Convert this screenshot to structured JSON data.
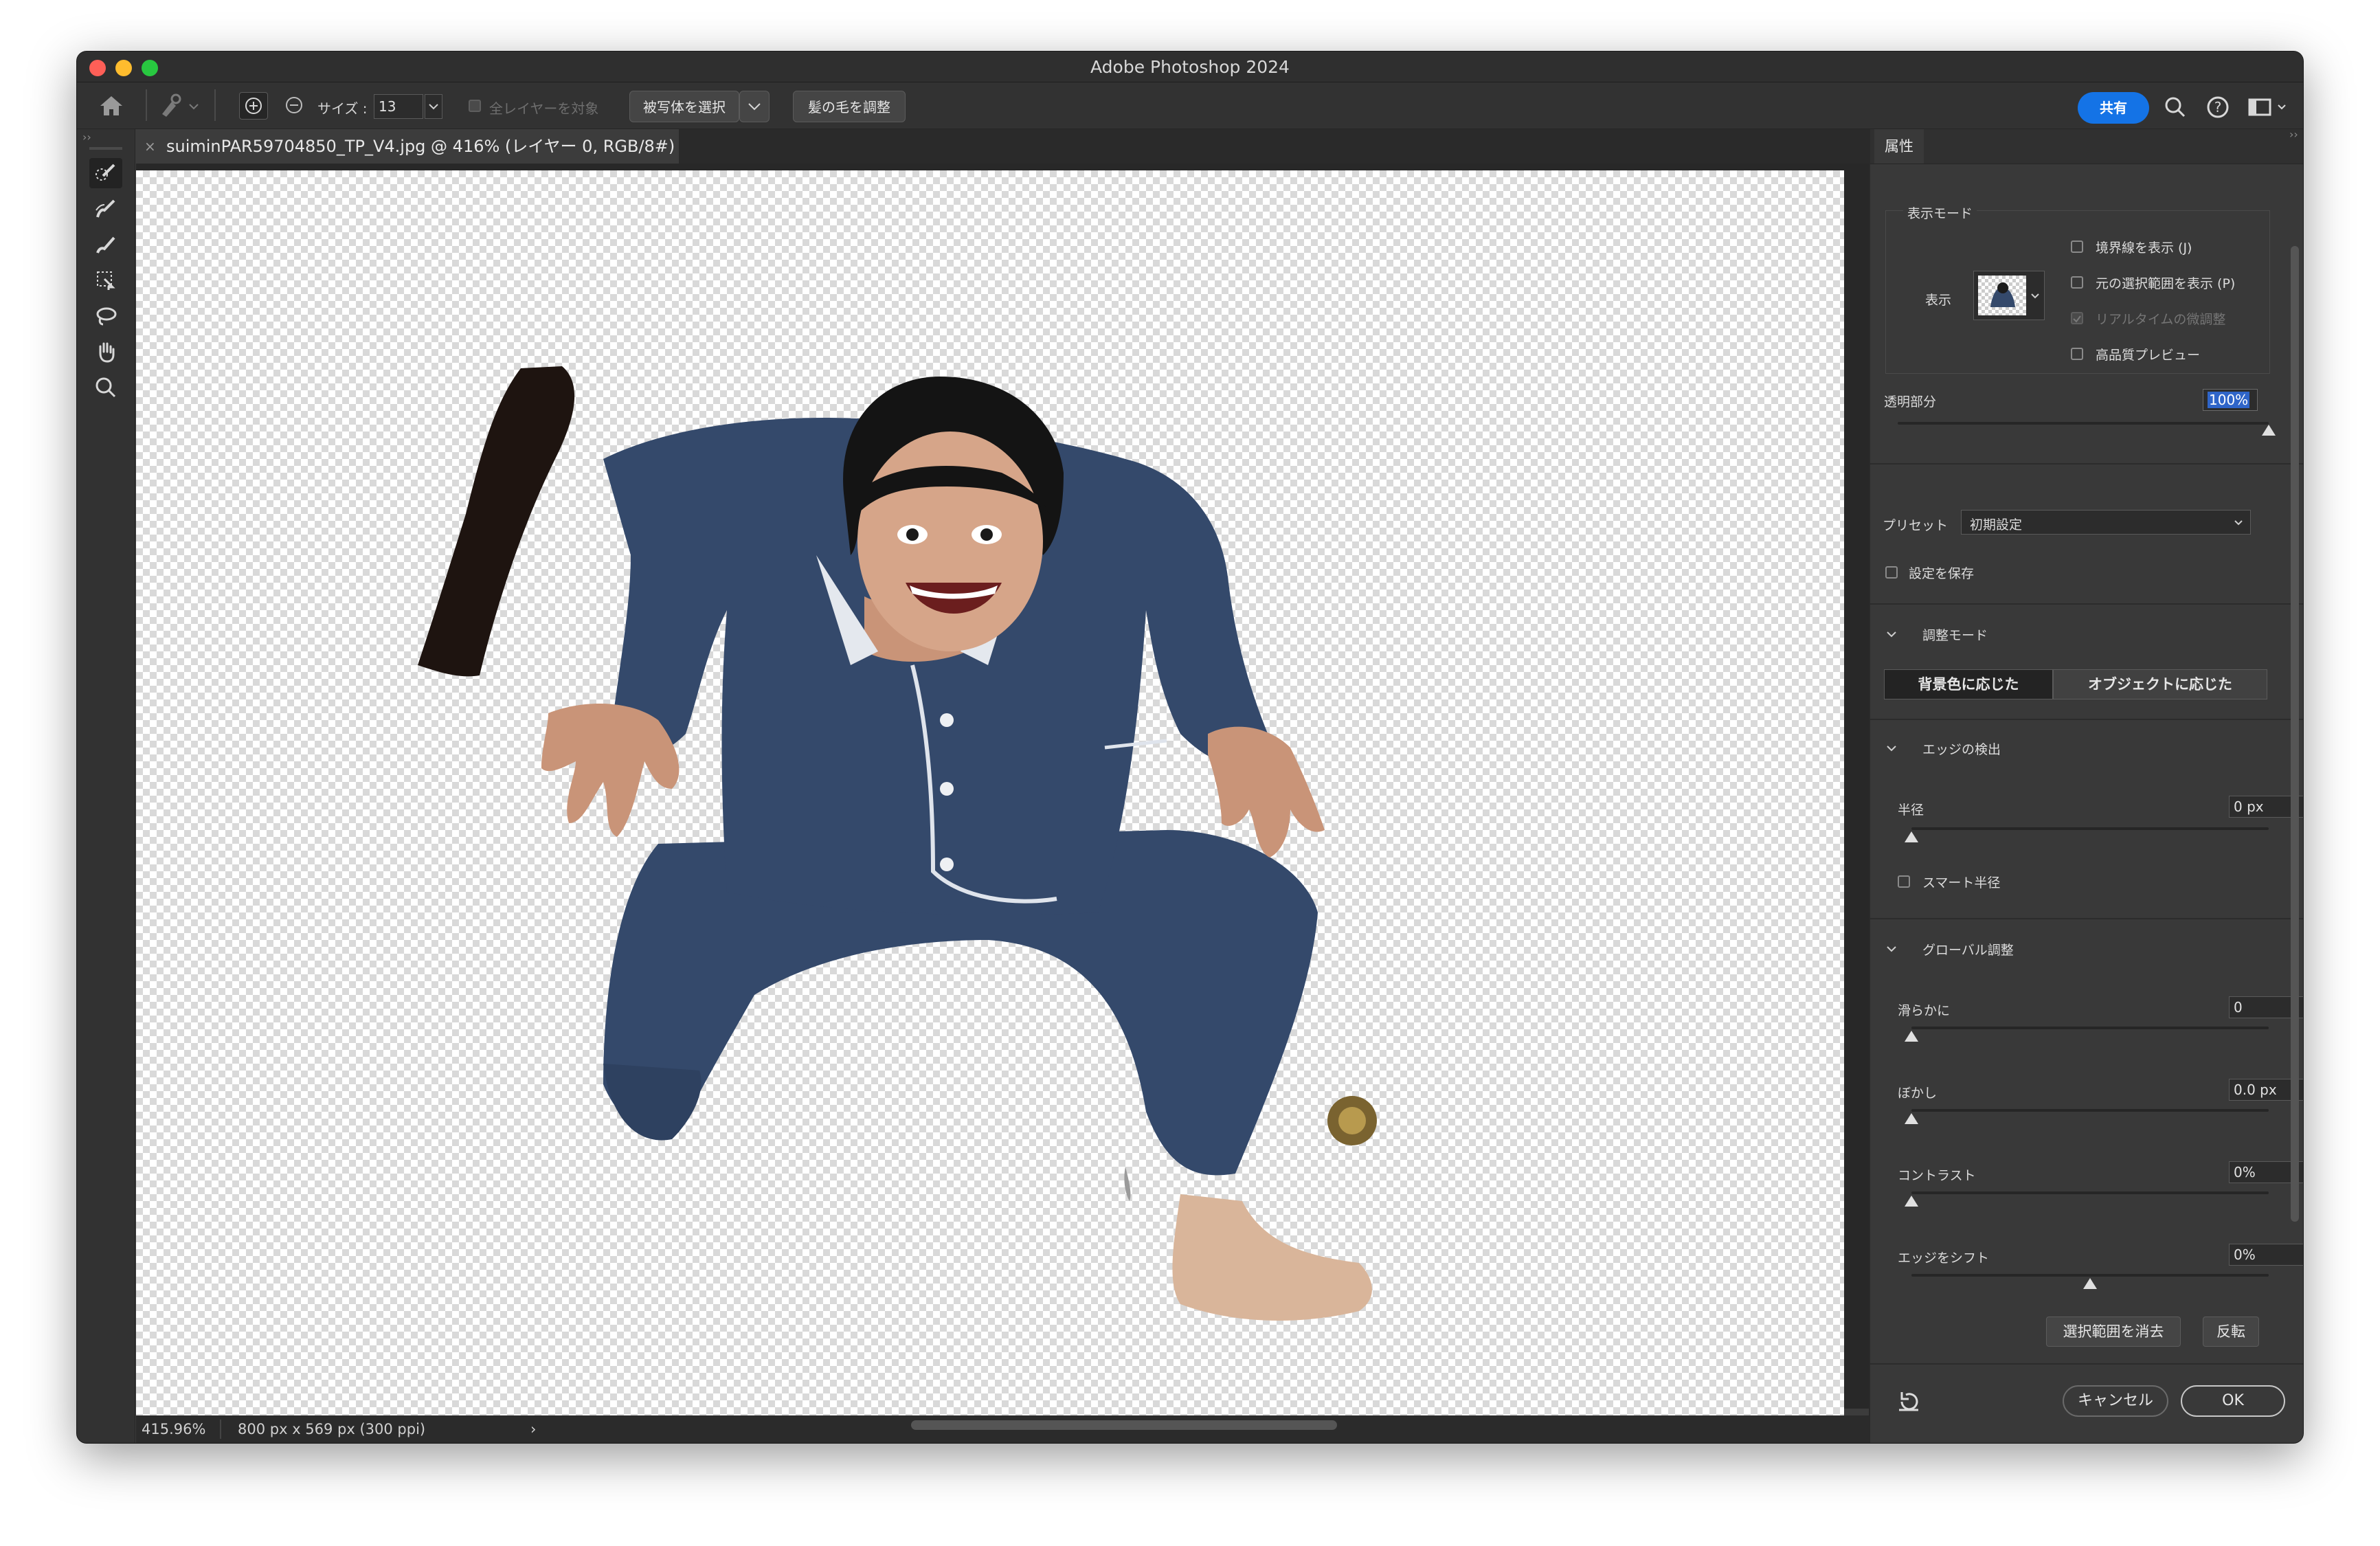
{
  "window": {
    "title": "Adobe Photoshop 2024"
  },
  "options_bar": {
    "size_label": "サイズ :",
    "size_value": "13",
    "sample_all_layers": "全レイヤーを対象",
    "select_subject": "被写体を選択",
    "refine_hair": "髪の毛を調整",
    "share": "共有"
  },
  "document": {
    "tab_title": "suiminPAR59704850_TP_V4.jpg @ 416% (レイヤー 0, RGB/8#)",
    "zoom": "415.96%",
    "dimensions": "800 px x 569 px (300 ppi)",
    "status_arrow": "›"
  },
  "tools": [
    {
      "name": "quick-selection-icon"
    },
    {
      "name": "refine-edge-brush-icon"
    },
    {
      "name": "brush-icon"
    },
    {
      "name": "object-selection-icon"
    },
    {
      "name": "lasso-icon"
    },
    {
      "name": "hand-icon"
    },
    {
      "name": "zoom-icon"
    }
  ],
  "properties_panel": {
    "tab": "属性",
    "view_mode": {
      "header": "表示モード",
      "view_label": "表示",
      "options": [
        {
          "label": "境界線を表示 (J)",
          "checked": false,
          "disabled": false
        },
        {
          "label": "元の選択範囲を表示 (P)",
          "checked": false,
          "disabled": false
        },
        {
          "label": "リアルタイムの微調整",
          "checked": true,
          "disabled": true
        },
        {
          "label": "高品質プレビュー",
          "checked": false,
          "disabled": false
        }
      ]
    },
    "transparency": {
      "label": "透明部分",
      "value": "100%",
      "level": 1.0
    },
    "preset": {
      "label": "プリセット",
      "value": "初期設定"
    },
    "save_settings": "設定を保存",
    "adjust_mode": {
      "header": "調整モード",
      "background_aware": "背景色に応じた",
      "object_aware": "オブジェクトに応じた"
    },
    "edge_detection": {
      "header": "エッジの検出",
      "radius_label": "半径",
      "radius_value": "0 px",
      "radius_level": 0,
      "smart_radius": "スマート半径"
    },
    "global_refinements": {
      "header": "グローバル調整",
      "smooth_label": "滑らかに",
      "smooth_value": "0",
      "smooth_level": 0,
      "feather_label": "ぼかし",
      "feather_value": "0.0 px",
      "feather_level": 0,
      "contrast_label": "コントラスト",
      "contrast_value": "0%",
      "contrast_level": 0,
      "shift_edge_label": "エッジをシフト",
      "shift_edge_value": "0%",
      "shift_edge_level": 0.5,
      "clear_selection": "選択範囲を消去",
      "invert": "反転"
    },
    "cancel": "キャンセル",
    "ok": "OK"
  },
  "colors": {
    "accent": "#1473e6",
    "pajama": "#34496b",
    "canvas_checker": "#d9d9d9"
  }
}
